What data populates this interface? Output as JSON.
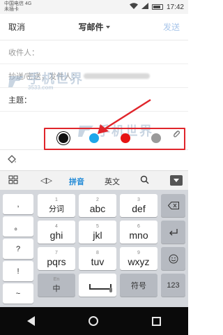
{
  "status_bar": {
    "carrier": "中国电信 4G",
    "carrier_sub": "未插卡",
    "time": "17:42"
  },
  "header": {
    "cancel_label": "取消",
    "title": "写邮件",
    "send_label": "发送"
  },
  "fields": {
    "to_label": "收件人：",
    "cc_label": "抄送/密送，发件人：",
    "subject_label": "主题："
  },
  "color_picker": {
    "colors": [
      "#111111",
      "#1ea7ea",
      "#e61414",
      "#9a9a9a"
    ],
    "selected": "#111111",
    "highlight_color": "#e0252b"
  },
  "watermark": {
    "text": "手机世界",
    "sub": "3533.com"
  },
  "keyboard": {
    "toolbar": {
      "cursor_glyph": "◁▷",
      "pinyin_label": "拼音",
      "english_label": "英文"
    },
    "side_keys": [
      ",",
      "。",
      "?",
      "!",
      "~"
    ],
    "rows": [
      [
        {
          "main": "分词",
          "sub": "1"
        },
        {
          "main": "abc",
          "sub": "2"
        },
        {
          "main": "def",
          "sub": "3"
        }
      ],
      [
        {
          "main": "ghi",
          "sub": "4"
        },
        {
          "main": "jkl",
          "sub": "5"
        },
        {
          "main": "mno",
          "sub": "6"
        }
      ],
      [
        {
          "main": "pqrs",
          "sub": "7"
        },
        {
          "main": "tuv",
          "sub": "8"
        },
        {
          "main": "wxyz",
          "sub": "9"
        }
      ]
    ],
    "bottom_row": {
      "lang_main": "中",
      "lang_sub": "En",
      "symbol_label": "符号",
      "number_label": "123"
    }
  }
}
